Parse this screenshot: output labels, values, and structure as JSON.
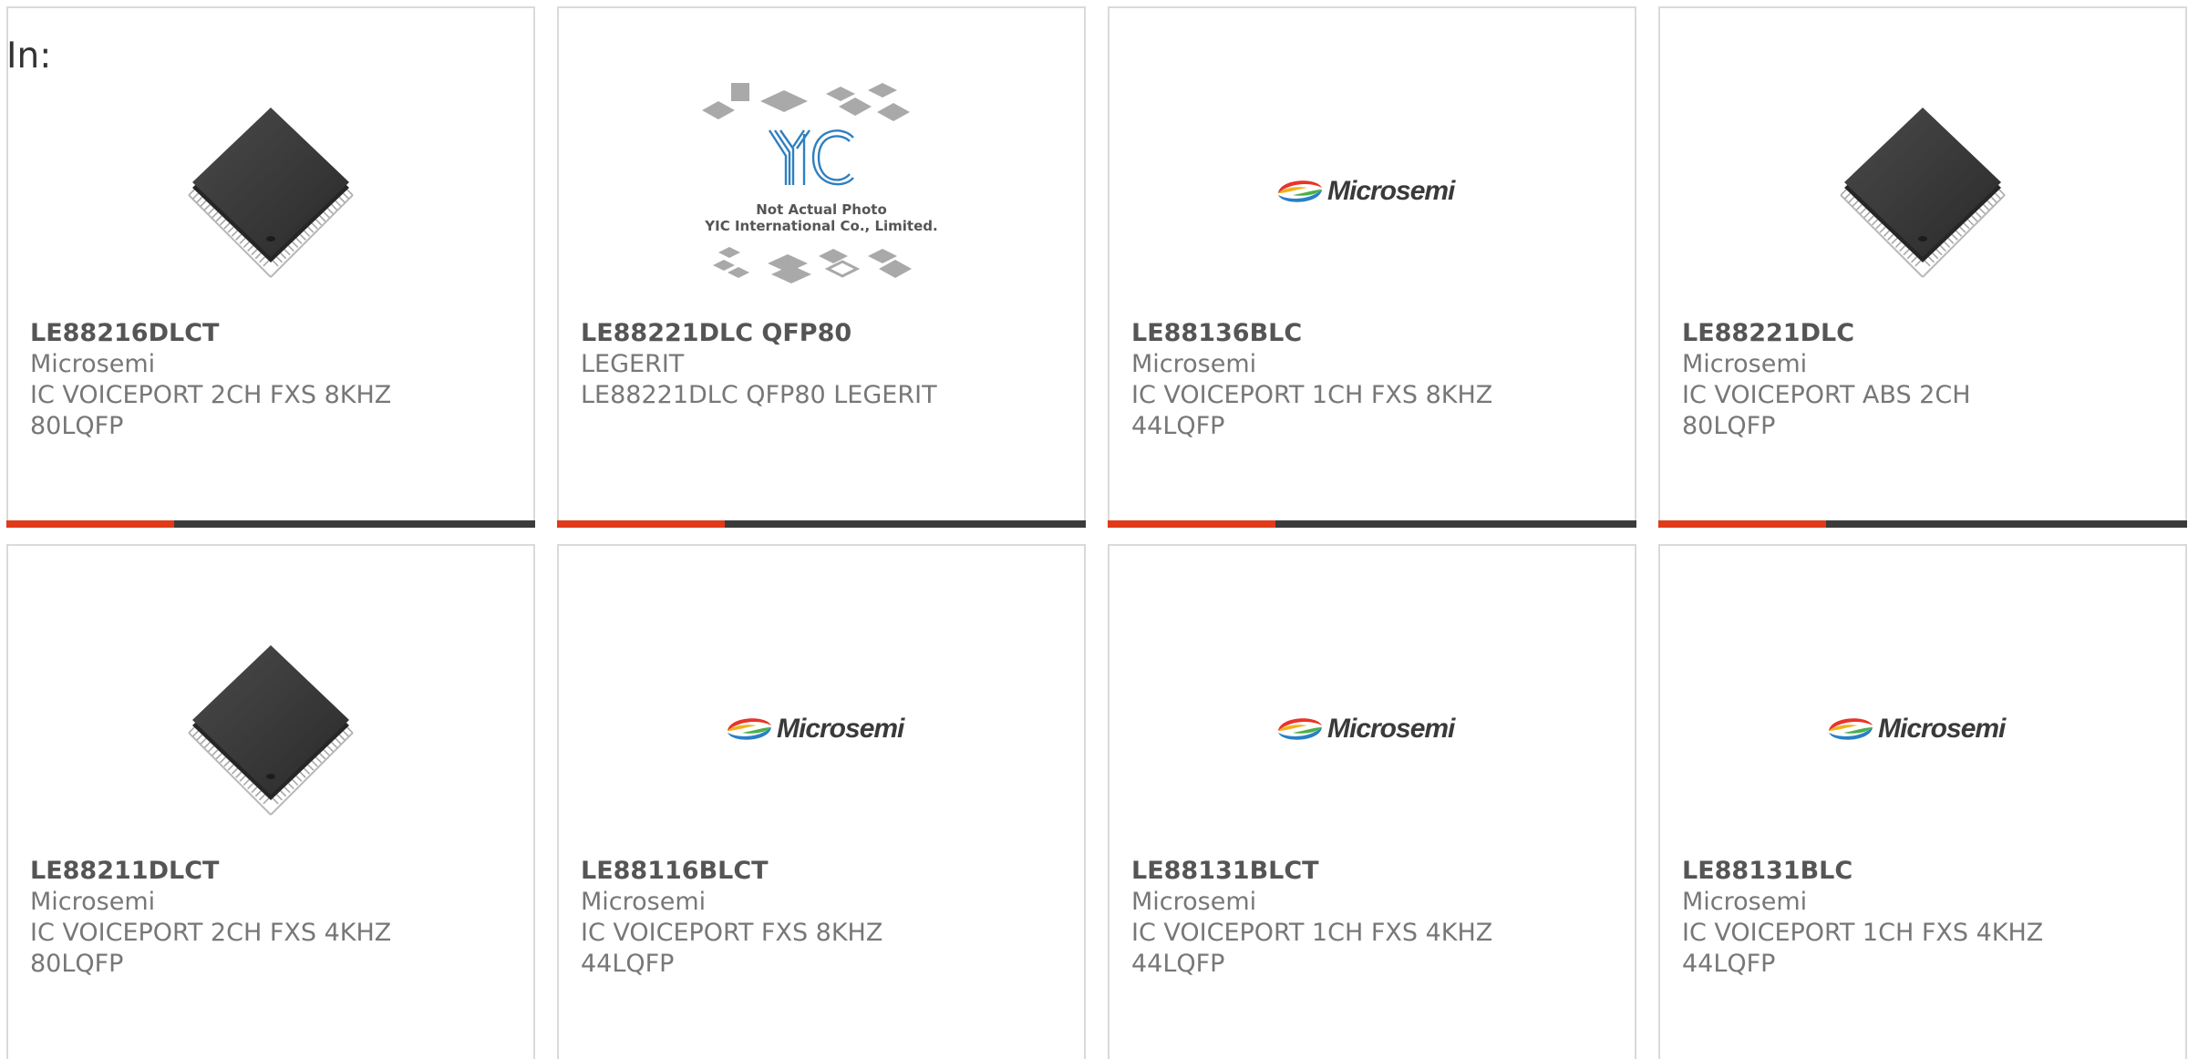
{
  "header": {
    "label": "In:"
  },
  "cards": [
    {
      "part": "LE88216DLCT",
      "mfr": "Microsemi",
      "desc": "IC VOICEPORT 2CH FXS 8KHZ 80LQFP",
      "image": "chip"
    },
    {
      "part": "LE88221DLC QFP80",
      "mfr": "LEGERIT",
      "desc": "LE88221DLC QFP80 LEGERIT",
      "image": "placeholder",
      "placeholder_line1": "Not Actual Photo",
      "placeholder_line2": "YIC International Co., Limited.",
      "placeholder_logo": "YIC"
    },
    {
      "part": "LE88136BLC",
      "mfr": "Microsemi",
      "desc": "IC VOICEPORT 1CH FXS 8KHZ 44LQFP",
      "image": "logo",
      "logo_text": "Microsemi"
    },
    {
      "part": "LE88221DLC",
      "mfr": "Microsemi",
      "desc": "IC VOICEPORT ABS 2CH 80LQFP",
      "image": "chip"
    },
    {
      "part": "LE88211DLCT",
      "mfr": "Microsemi",
      "desc": "IC VOICEPORT 2CH FXS 4KHZ 80LQFP",
      "image": "chip"
    },
    {
      "part": "LE88116BLCT",
      "mfr": "Microsemi",
      "desc": "IC VOICEPORT FXS 8KHZ 44LQFP",
      "image": "logo",
      "logo_text": "Microsemi"
    },
    {
      "part": "LE88131BLCT",
      "mfr": "Microsemi",
      "desc": "IC VOICEPORT 1CH FXS 4KHZ 44LQFP",
      "image": "logo",
      "logo_text": "Microsemi"
    },
    {
      "part": "LE88131BLC",
      "mfr": "Microsemi",
      "desc": "IC VOICEPORT 1CH FXS 4KHZ 44LQFP",
      "image": "logo",
      "logo_text": "Microsemi"
    }
  ],
  "colors": {
    "accent": "#e03a1a",
    "bar": "#3b3b3b",
    "border": "#dadada",
    "text_dark": "#555555",
    "text_light": "#777777"
  }
}
